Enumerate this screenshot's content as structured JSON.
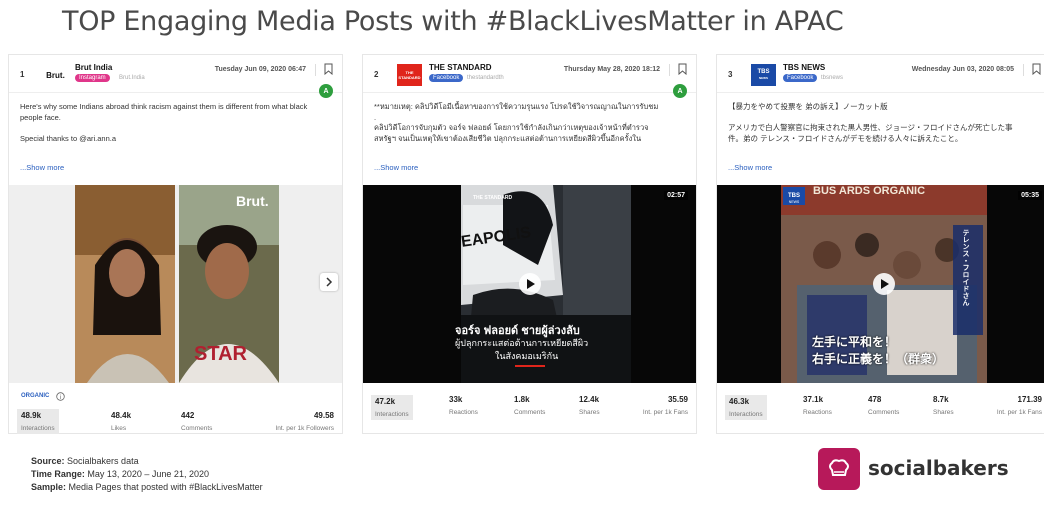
{
  "slide_title": "TOP Engaging Media Posts with #BlackLivesMatter in APAC",
  "posts": [
    {
      "rank": "1",
      "logo_text": "Brut.",
      "page_name": "Brut India",
      "platform": "Instagram",
      "handle": "Brut.India",
      "date": "Tuesday Jun 09, 2020 06:47",
      "badge": "A",
      "text": "Here's why some Indians abroad think racism against them is different from what black people face.\n\nSpecial thanks to @ari.ann.a",
      "show_more": "...Show more",
      "media_tag": "Brut.",
      "organic_label": "ORGANIC",
      "stats": [
        {
          "value": "48.9k",
          "label": "Interactions"
        },
        {
          "value": "48.4k",
          "label": "Likes"
        },
        {
          "value": "442",
          "label": "Comments"
        },
        {
          "value": "49.58",
          "label": "Int. per 1k Followers"
        }
      ]
    },
    {
      "rank": "2",
      "logo_text": "THE STANDARD",
      "page_name": "THE STANDARD",
      "platform": "Facebook",
      "handle": "thestandardth",
      "date": "Thursday May 28, 2020 18:12",
      "badge": "A",
      "text": "**หมายเหตุ: คลิปวิดีโอมีเนื้อหาของการใช้ความรุนแรง โปรดใช้วิจารณญาณในการรับชม\n.\nคลิปวิดีโอการจับกุมตัว จอร์จ ฟลอยด์ โดยการใช้กำลังเกินกว่าเหตุของเจ้าหน้าที่ตำรวจสหรัฐฯ จนเป็นเหตุให้เขาต้องเสียชีวิต ปลุกกระแสต่อต้านการเหยียดสีผิวขึ้นอีกครั้งใน",
      "show_more": "...Show more",
      "duration": "02:57",
      "media_caption_1": "จอร์จ ฟลอยด์ ชายผู้ล่วงลับ",
      "media_caption_2": "ผู้ปลุกกระแสต่อต้านการเหยียดสีผิว",
      "media_caption_3": "ในสังคมอเมริกัน",
      "media_logo": "THE STANDARD",
      "media_sign": "EAPOLIS",
      "stats": [
        {
          "value": "47.2k",
          "label": "Interactions"
        },
        {
          "value": "33k",
          "label": "Reactions"
        },
        {
          "value": "1.8k",
          "label": "Comments"
        },
        {
          "value": "12.4k",
          "label": "Shares"
        },
        {
          "value": "35.59",
          "label": "Int. per 1k Fans"
        }
      ]
    },
    {
      "rank": "3",
      "logo_text": "TBS NEWS",
      "page_name": "TBS NEWS",
      "platform": "Facebook",
      "handle": "tbsnews",
      "date": "Wednesday Jun 03, 2020 08:05",
      "text": "【暴力をやめて投票を 弟の訴え】ノーカット版\n\nアメリカで白人警察官に拘束された黒人男性、ジョージ・フロイドさんが死亡した事件。弟の テレンス・フロイドさんがデモを続ける人々に訴えたこと。",
      "show_more": "...Show more",
      "duration": "05:35",
      "media_sign": "BUS  ARDS ORGANIC",
      "media_caption_1": "左手に平和を！",
      "media_caption_2": "右手に正義を！（群衆）",
      "media_side_caption": "テレンス・フロイドさん",
      "stats": [
        {
          "value": "46.3k",
          "label": "Interactions"
        },
        {
          "value": "37.1k",
          "label": "Reactions"
        },
        {
          "value": "478",
          "label": "Comments"
        },
        {
          "value": "8.7k",
          "label": "Shares"
        },
        {
          "value": "171.39",
          "label": "Int. per 1k Fans"
        }
      ]
    }
  ],
  "footer": {
    "source_label": "Source:",
    "source_value": "Socialbakers data",
    "range_label": "Time Range:",
    "range_value": "May 13, 2020 – June 21, 2020",
    "sample_label": "Sample:",
    "sample_value": "Media Pages that posted with #BlackLivesMatter"
  },
  "brand": {
    "name": "socialbakers",
    "color": "#b7195a"
  }
}
